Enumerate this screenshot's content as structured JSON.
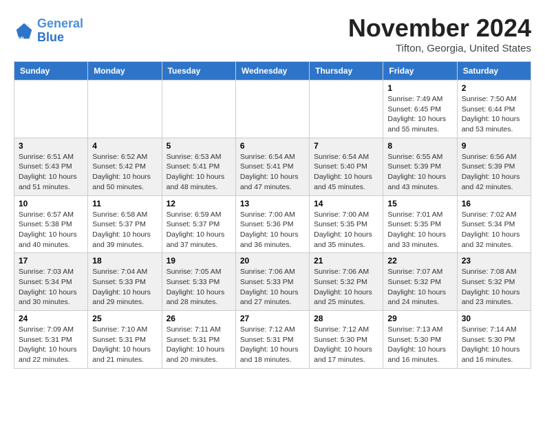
{
  "logo": {
    "line1": "General",
    "line2": "Blue"
  },
  "title": "November 2024",
  "location": "Tifton, Georgia, United States",
  "days_of_week": [
    "Sunday",
    "Monday",
    "Tuesday",
    "Wednesday",
    "Thursday",
    "Friday",
    "Saturday"
  ],
  "weeks": [
    [
      {
        "day": "",
        "info": ""
      },
      {
        "day": "",
        "info": ""
      },
      {
        "day": "",
        "info": ""
      },
      {
        "day": "",
        "info": ""
      },
      {
        "day": "",
        "info": ""
      },
      {
        "day": "1",
        "info": "Sunrise: 7:49 AM\nSunset: 6:45 PM\nDaylight: 10 hours and 55 minutes."
      },
      {
        "day": "2",
        "info": "Sunrise: 7:50 AM\nSunset: 6:44 PM\nDaylight: 10 hours and 53 minutes."
      }
    ],
    [
      {
        "day": "3",
        "info": "Sunrise: 6:51 AM\nSunset: 5:43 PM\nDaylight: 10 hours and 51 minutes."
      },
      {
        "day": "4",
        "info": "Sunrise: 6:52 AM\nSunset: 5:42 PM\nDaylight: 10 hours and 50 minutes."
      },
      {
        "day": "5",
        "info": "Sunrise: 6:53 AM\nSunset: 5:41 PM\nDaylight: 10 hours and 48 minutes."
      },
      {
        "day": "6",
        "info": "Sunrise: 6:54 AM\nSunset: 5:41 PM\nDaylight: 10 hours and 47 minutes."
      },
      {
        "day": "7",
        "info": "Sunrise: 6:54 AM\nSunset: 5:40 PM\nDaylight: 10 hours and 45 minutes."
      },
      {
        "day": "8",
        "info": "Sunrise: 6:55 AM\nSunset: 5:39 PM\nDaylight: 10 hours and 43 minutes."
      },
      {
        "day": "9",
        "info": "Sunrise: 6:56 AM\nSunset: 5:39 PM\nDaylight: 10 hours and 42 minutes."
      }
    ],
    [
      {
        "day": "10",
        "info": "Sunrise: 6:57 AM\nSunset: 5:38 PM\nDaylight: 10 hours and 40 minutes."
      },
      {
        "day": "11",
        "info": "Sunrise: 6:58 AM\nSunset: 5:37 PM\nDaylight: 10 hours and 39 minutes."
      },
      {
        "day": "12",
        "info": "Sunrise: 6:59 AM\nSunset: 5:37 PM\nDaylight: 10 hours and 37 minutes."
      },
      {
        "day": "13",
        "info": "Sunrise: 7:00 AM\nSunset: 5:36 PM\nDaylight: 10 hours and 36 minutes."
      },
      {
        "day": "14",
        "info": "Sunrise: 7:00 AM\nSunset: 5:35 PM\nDaylight: 10 hours and 35 minutes."
      },
      {
        "day": "15",
        "info": "Sunrise: 7:01 AM\nSunset: 5:35 PM\nDaylight: 10 hours and 33 minutes."
      },
      {
        "day": "16",
        "info": "Sunrise: 7:02 AM\nSunset: 5:34 PM\nDaylight: 10 hours and 32 minutes."
      }
    ],
    [
      {
        "day": "17",
        "info": "Sunrise: 7:03 AM\nSunset: 5:34 PM\nDaylight: 10 hours and 30 minutes."
      },
      {
        "day": "18",
        "info": "Sunrise: 7:04 AM\nSunset: 5:33 PM\nDaylight: 10 hours and 29 minutes."
      },
      {
        "day": "19",
        "info": "Sunrise: 7:05 AM\nSunset: 5:33 PM\nDaylight: 10 hours and 28 minutes."
      },
      {
        "day": "20",
        "info": "Sunrise: 7:06 AM\nSunset: 5:33 PM\nDaylight: 10 hours and 27 minutes."
      },
      {
        "day": "21",
        "info": "Sunrise: 7:06 AM\nSunset: 5:32 PM\nDaylight: 10 hours and 25 minutes."
      },
      {
        "day": "22",
        "info": "Sunrise: 7:07 AM\nSunset: 5:32 PM\nDaylight: 10 hours and 24 minutes."
      },
      {
        "day": "23",
        "info": "Sunrise: 7:08 AM\nSunset: 5:32 PM\nDaylight: 10 hours and 23 minutes."
      }
    ],
    [
      {
        "day": "24",
        "info": "Sunrise: 7:09 AM\nSunset: 5:31 PM\nDaylight: 10 hours and 22 minutes."
      },
      {
        "day": "25",
        "info": "Sunrise: 7:10 AM\nSunset: 5:31 PM\nDaylight: 10 hours and 21 minutes."
      },
      {
        "day": "26",
        "info": "Sunrise: 7:11 AM\nSunset: 5:31 PM\nDaylight: 10 hours and 20 minutes."
      },
      {
        "day": "27",
        "info": "Sunrise: 7:12 AM\nSunset: 5:31 PM\nDaylight: 10 hours and 18 minutes."
      },
      {
        "day": "28",
        "info": "Sunrise: 7:12 AM\nSunset: 5:30 PM\nDaylight: 10 hours and 17 minutes."
      },
      {
        "day": "29",
        "info": "Sunrise: 7:13 AM\nSunset: 5:30 PM\nDaylight: 10 hours and 16 minutes."
      },
      {
        "day": "30",
        "info": "Sunrise: 7:14 AM\nSunset: 5:30 PM\nDaylight: 10 hours and 16 minutes."
      }
    ]
  ]
}
